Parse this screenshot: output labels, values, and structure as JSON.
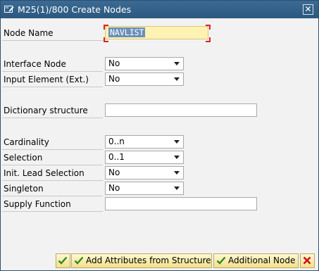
{
  "window": {
    "title": "M25(1)/800 Create Nodes",
    "icons": {
      "title": "edit-window-icon",
      "close": "close-icon"
    },
    "close_glyph": "✕"
  },
  "form": {
    "node_name": {
      "label": "Node Name",
      "value": "NAVLIST"
    },
    "interface_node": {
      "label": "Interface Node",
      "value": "No"
    },
    "input_element": {
      "label": "Input Element (Ext.)",
      "value": "No"
    },
    "dictionary_structure": {
      "label": "Dictionary structure",
      "value": ""
    },
    "cardinality": {
      "label": "Cardinality",
      "value": "0..n"
    },
    "selection": {
      "label": "Selection",
      "value": "0..1"
    },
    "init_lead_selection": {
      "label": "Init. Lead Selection",
      "value": "No"
    },
    "singleton": {
      "label": "Singleton",
      "value": "No"
    },
    "supply_function": {
      "label": "Supply Function",
      "value": ""
    }
  },
  "footer": {
    "add_attributes_label": "Add Attributes from Structure",
    "additional_node_label": "Additional Node",
    "colors": {
      "check": "#2e8b1e",
      "cancel": "#d01010"
    }
  }
}
